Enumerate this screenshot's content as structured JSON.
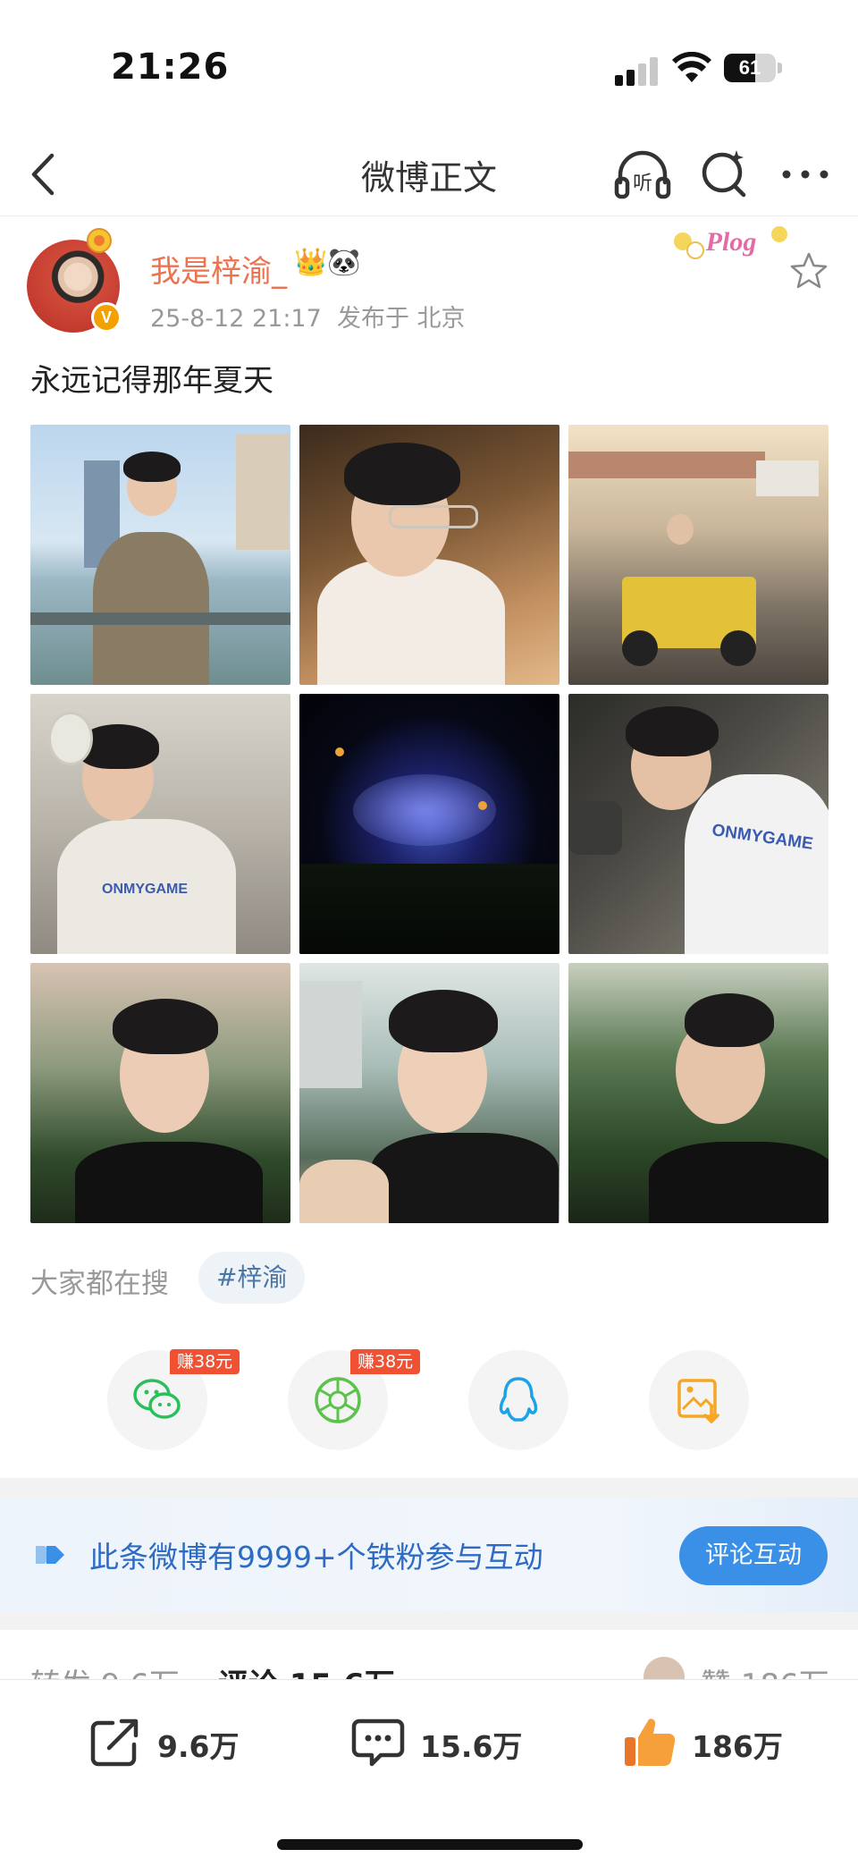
{
  "status_bar": {
    "time": "21:26",
    "battery": "61",
    "battery_level": 0.61
  },
  "nav": {
    "title": "微博正文",
    "listen_label": "听"
  },
  "post": {
    "username": "我是梓渝_",
    "username_emojis": "👑🐼",
    "timestamp": "25-8-12 21:17",
    "location": "发布于 北京",
    "verified_badge": "V",
    "sticker_text": "Plog",
    "text": "永远记得那年夏天",
    "photo_captions": {
      "p4_shirt": "ONMYGAME",
      "p6_shirt": "ONMYGAME"
    }
  },
  "search": {
    "label": "大家都在搜",
    "hashtag": "#梓渝"
  },
  "share": {
    "reward_wechat": "赚38元",
    "reward_moments": "赚38元"
  },
  "fan_banner": {
    "text": "此条微博有9999+个铁粉参与互动",
    "button": "评论互动"
  },
  "tabs": {
    "repost": "转发 9.6万",
    "comment": "评论 15.6万",
    "like": "赞 186万"
  },
  "actions": {
    "repost_count": "9.6万",
    "comment_count": "15.6万",
    "like_count": "186万"
  },
  "colors": {
    "username": "#eb7350",
    "link": "#2d6bc4",
    "reward": "#f05133",
    "like": "#f08a1c"
  }
}
